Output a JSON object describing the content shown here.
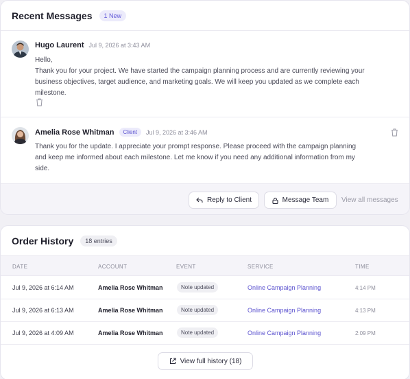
{
  "messages_card": {
    "title": "Recent Messages",
    "badge": "1 New",
    "messages": [
      {
        "author": "Hugo Laurent",
        "role": "",
        "time": "Jul 9, 2026 at 3:43 AM",
        "body_lines": [
          "Hello,",
          "Thank you for your project. We have started the campaign planning process and are currently reviewing your",
          "business objectives, target audience, and marketing goals. We will keep you updated as we complete each",
          "milestone."
        ]
      },
      {
        "author": "Amelia Rose Whitman",
        "role": "Client",
        "time": "Jul 9, 2026 at 3:46 AM",
        "body_lines": [
          "Thank you for the update. I appreciate your prompt response. Please proceed with the campaign planning",
          "and keep me informed about each milestone. Let me know if you need any additional information from my",
          "side."
        ]
      }
    ],
    "actions": {
      "reply": "Reply to Client",
      "message_team": "Message Team",
      "view_all": "View all messages"
    }
  },
  "orders_card": {
    "title": "Order History",
    "badge": "18 entries",
    "columns": [
      "DATE",
      "ACCOUNT",
      "EVENT",
      "SERVICE",
      "TIME"
    ],
    "rows": [
      {
        "date": "Jul 9, 2026 at 6:14 AM",
        "account": "Amelia Rose Whitman",
        "event": "Note updated",
        "service": "Online Campaign Planning",
        "time": "4:14 PM"
      },
      {
        "date": "Jul 9, 2026 at 6:13 AM",
        "account": "Amelia Rose Whitman",
        "event": "Note updated",
        "service": "Online Campaign Planning",
        "time": "4:13 PM"
      },
      {
        "date": "Jul 9, 2026 at 4:09 AM",
        "account": "Amelia Rose Whitman",
        "event": "Note updated",
        "service": "Online Campaign Planning",
        "time": "2:09 PM"
      }
    ],
    "view_full": "View full history (18)"
  },
  "icons": {
    "trash": "trash-icon",
    "reply": "reply-arrow-icon",
    "lock": "lock-icon",
    "external": "external-link-icon"
  },
  "colors": {
    "accent": "#5b52cf",
    "badge_bg": "#ecebfb",
    "page_bg": "#f1f0f5"
  }
}
